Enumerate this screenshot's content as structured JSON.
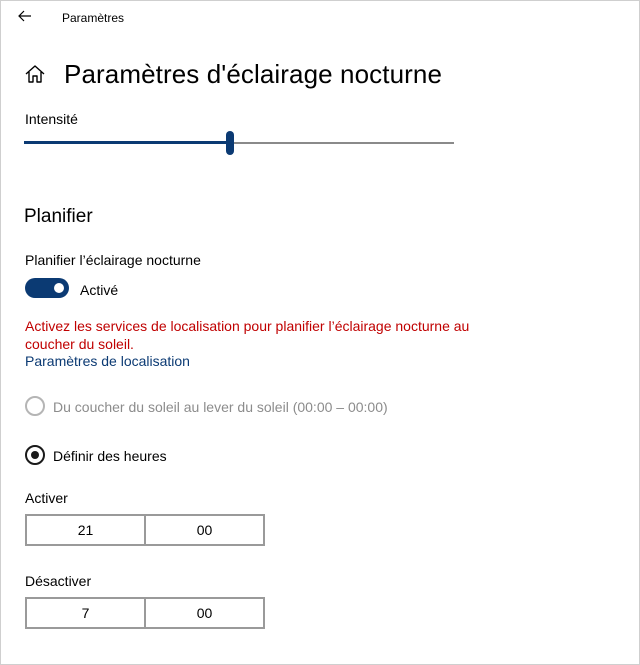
{
  "titlebar": {
    "app_title": "Paramètres"
  },
  "header": {
    "title": "Paramètres d'éclairage nocturne"
  },
  "intensity": {
    "label": "Intensité",
    "value_percent": 48
  },
  "schedule": {
    "section_title": "Planifier",
    "toggle_label": "Planifier l’éclairage nocturne",
    "toggle_state": "Activé",
    "warning": "Activez les services de localisation pour planifier l’éclairage nocturne au coucher du soleil.",
    "location_link": "Paramètres de localisation",
    "options": [
      {
        "label": "Du coucher du soleil au lever du soleil (00:00 – 00:00)",
        "selected": false,
        "disabled": true
      },
      {
        "label": "Définir des heures",
        "selected": true,
        "disabled": false
      }
    ]
  },
  "turn_on": {
    "label": "Activer",
    "hour": "21",
    "minute": "00"
  },
  "turn_off": {
    "label": "Désactiver",
    "hour": "7",
    "minute": "00"
  },
  "colors": {
    "accent": "#0b3a73",
    "warning": "#c00000",
    "disabled": "#8c8c8c"
  }
}
